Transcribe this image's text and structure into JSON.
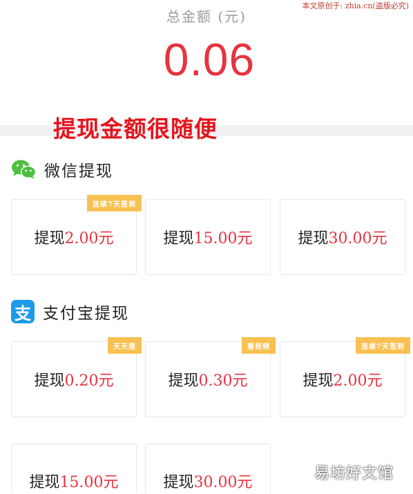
{
  "watermark_top": "本文原创于: zhia.cn(盗版必究)",
  "total": {
    "label": "总金额 (元)",
    "value": "0.06"
  },
  "overlay_text": "提现金额很随便",
  "wechat": {
    "title": "微信提现",
    "icon": "wechat-icon",
    "options": [
      {
        "prefix": "提现",
        "amount": "2.00元",
        "badge": "连续7天签到"
      },
      {
        "prefix": "提现",
        "amount": "15.00元",
        "badge": null
      },
      {
        "prefix": "提现",
        "amount": "30.00元",
        "badge": null
      }
    ]
  },
  "alipay": {
    "title": "支付宝提现",
    "icon": "alipay-icon",
    "icon_glyph": "支",
    "options": [
      {
        "prefix": "提现",
        "amount": "0.20元",
        "badge": "天天提"
      },
      {
        "prefix": "提现",
        "amount": "0.30元",
        "badge": "看视频"
      },
      {
        "prefix": "提现",
        "amount": "2.00元",
        "badge": "连续7天签到"
      },
      {
        "prefix": "提现",
        "amount": "15.00元",
        "badge": null
      },
      {
        "prefix": "提现",
        "amount": "30.00元",
        "badge": null
      }
    ]
  },
  "watermark_bottom": "易坊好文馆",
  "colors": {
    "accent_red": "#e8333f",
    "badge": "#f8c152",
    "wechat_green": "#4cbf3f",
    "alipay_blue": "#1d9ae8"
  }
}
